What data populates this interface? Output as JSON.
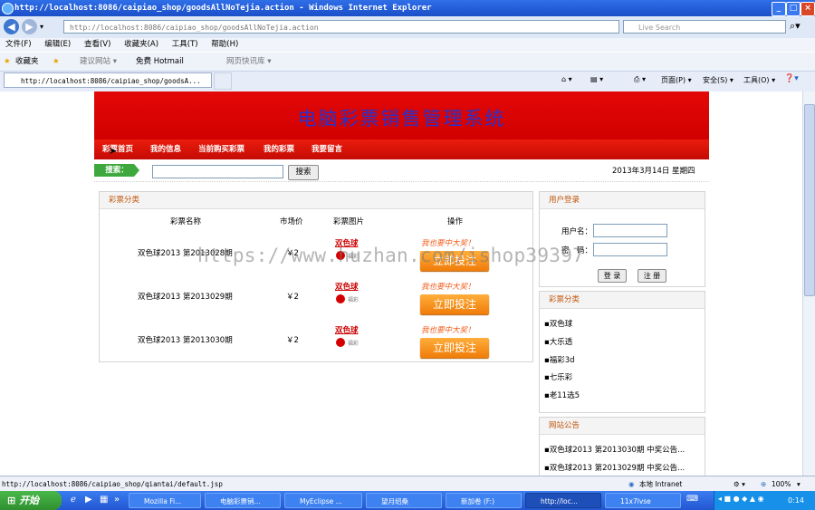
{
  "browser": {
    "title": "http://localhost:8086/caipiao_shop/goodsAllNoTejia.action - Windows Internet Explorer",
    "address": "http://localhost:8086/caipiao_shop/goodsAllNoTejia.action",
    "search_placeholder": "Live Search",
    "menu": [
      "文件(F)",
      "编辑(E)",
      "查看(V)",
      "收藏夹(A)",
      "工具(T)",
      "帮助(H)"
    ],
    "favorites_label": "收藏夹",
    "fav_links": [
      "建议网站 ▾",
      "免费 Hotmail",
      "网页快讯库 ▾"
    ],
    "tab_title": "http://localhost:8086/caipiao_shop/goodsA...",
    "cmd_page": "页面(P) ▾",
    "cmd_safety": "安全(S) ▾",
    "cmd_tools": "工具(O) ▾",
    "status_url": "http://localhost:8086/caipiao_shop/qiantai/default.jsp",
    "status_zone": "本地 Intranet",
    "zoom": "100%"
  },
  "site": {
    "title": "电脑彩票销售管理系统",
    "nav": [
      "彩票首页",
      "我的信息",
      "当前购买彩票",
      "我的彩票",
      "我要留言"
    ],
    "search_label": "搜索：",
    "search_button": "搜索",
    "date": "2013年3月14日 星期四"
  },
  "main": {
    "panel_title": "彩票分类",
    "columns": [
      "彩票名称",
      "市场价",
      "彩票图片",
      "操作"
    ],
    "rows": [
      {
        "name": "双色球2013 第2013028期",
        "price": "￥2",
        "logo": "双色球",
        "logo_sub": "福彩",
        "wish": "我也要中大奖！",
        "action": "立即投注"
      },
      {
        "name": "双色球2013 第2013029期",
        "price": "￥2",
        "logo": "双色球",
        "logo_sub": "福彩",
        "wish": "我也要中大奖！",
        "action": "立即投注"
      },
      {
        "name": "双色球2013 第2013030期",
        "price": "￥2",
        "logo": "双色球",
        "logo_sub": "福彩",
        "wish": "我也要中大奖！",
        "action": "立即投注"
      }
    ]
  },
  "login": {
    "title": "用户登录",
    "username_label": "用户名：",
    "password_label": "密　码：",
    "login_button": "登 录",
    "register_button": "注 册"
  },
  "categories": {
    "title": "彩票分类",
    "items": [
      "双色球",
      "大乐透",
      "福彩3d",
      "七乐彩",
      "老11选5"
    ]
  },
  "notice": {
    "title": "网站公告",
    "items": [
      "双色球2013 第2013030期 中奖公告...",
      "双色球2013 第2013029期 中奖公告..."
    ]
  },
  "watermark": "https://www.huzhan.com/ishop39397",
  "taskbar": {
    "start": "开始",
    "tasks": [
      "Mozilla Fi...",
      "电脑彩票销...",
      "MyEclipse ...",
      "望月绍桑",
      "新加卷 (F:)",
      "http://loc...",
      "11x7lvse"
    ],
    "clock": "0:14"
  }
}
